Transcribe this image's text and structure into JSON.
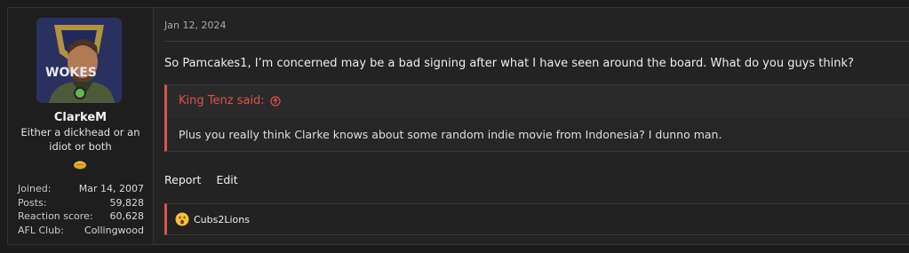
{
  "user": {
    "name": "ClarkeM",
    "title": "Either a dickhead or an idiot or both",
    "avatar_text": "WOKES",
    "stats": [
      {
        "label": "Joined:",
        "value": "Mar 14, 2007"
      },
      {
        "label": "Posts:",
        "value": "59,828"
      },
      {
        "label": "Reaction score:",
        "value": "60,628"
      },
      {
        "label": "AFL Club:",
        "value": "Collingwood"
      }
    ]
  },
  "post": {
    "date": "Jan 12, 2024",
    "message": "So Pamcakes1, I’m concerned may be a bad signing after what I have seen around the board. What do you guys think?",
    "quote": {
      "author": "King Tenz said:",
      "body": "Plus you really think Clarke knows about some random indie movie from Indonesia? I dunno man."
    },
    "actions": {
      "report": "Report",
      "edit": "Edit"
    },
    "reactions": {
      "user": "Cubs2Lions"
    }
  },
  "colors": {
    "accent": "#d9534f",
    "online": "#63b94f"
  }
}
